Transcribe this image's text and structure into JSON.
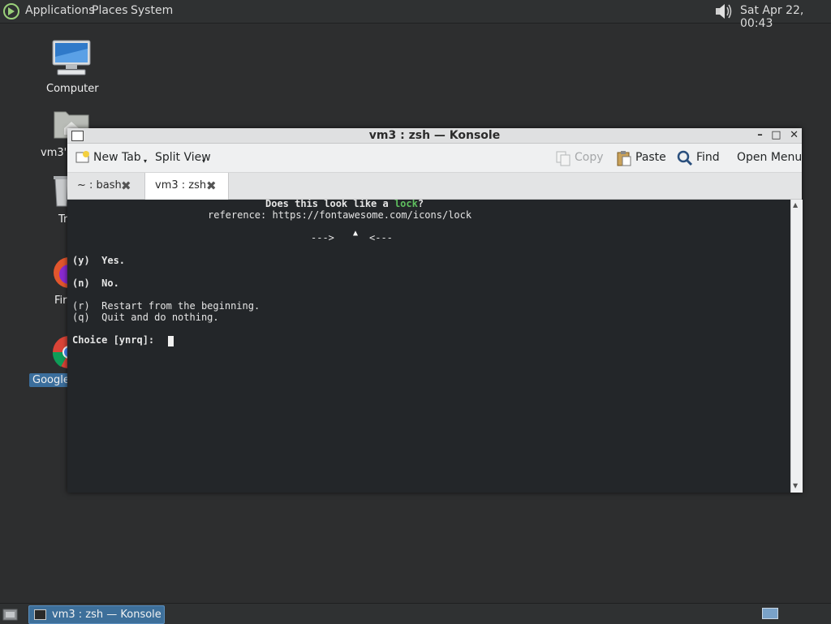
{
  "top_panel": {
    "menus": [
      "Applications",
      "Places",
      "System"
    ],
    "clock": "Sat Apr 22, 00:43"
  },
  "desktop": {
    "icons": [
      {
        "label": "Computer"
      },
      {
        "label": "vm3's"
      },
      {
        "label": "Tr"
      },
      {
        "label": "Fir"
      },
      {
        "label": "Google"
      }
    ]
  },
  "window": {
    "title": "vm3 : zsh — Konsole",
    "controls": {
      "minimize": "–",
      "maximize": "□",
      "close": "✕"
    },
    "toolbar": {
      "new_tab": "New Tab",
      "split_view": "Split View",
      "copy": "Copy",
      "paste": "Paste",
      "find": "Find",
      "open_menu": "Open Menu"
    },
    "tabs": [
      {
        "label": "~ : bash",
        "active": false
      },
      {
        "label": "vm3 : zsh",
        "active": true
      }
    ],
    "terminal": {
      "question_prefix": "Does this look like a ",
      "question_word": "lock",
      "question_suffix": "?",
      "reference": "reference: https://fontawesome.com/icons/lock",
      "arrows_left": "--->",
      "arrows_right": "<---",
      "opt_y": "(y)  Yes.",
      "opt_n": "(n)  No.",
      "opt_r": "(r)  Restart from the beginning.",
      "opt_q": "(q)  Quit and do nothing.",
      "prompt": "Choice [ynrq]:"
    }
  },
  "taskbar": {
    "task": "vm3 : zsh — Konsole"
  }
}
